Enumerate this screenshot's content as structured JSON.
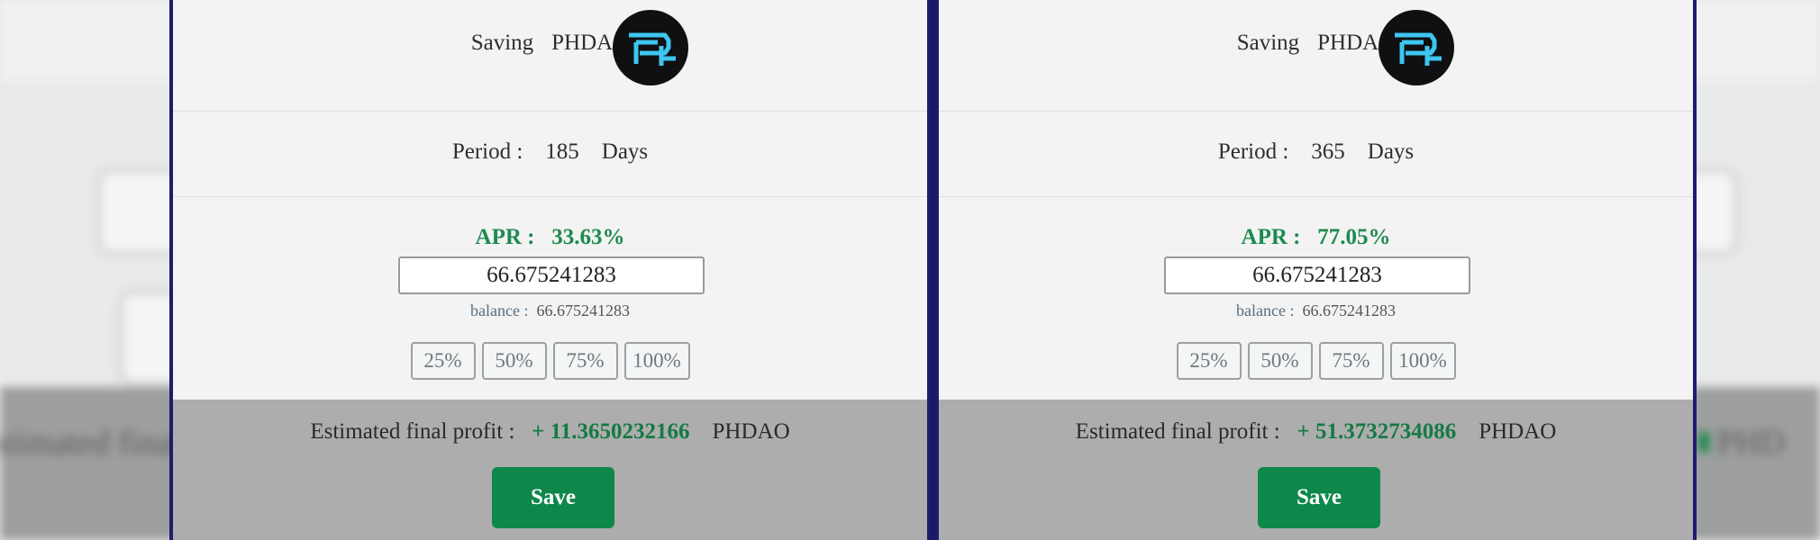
{
  "background": {
    "blurred_left_text": "Estimated final",
    "blurred_right_text": "PHD"
  },
  "panels": [
    {
      "saving_label": "Saving",
      "token": "PHDAO",
      "logo_icon": "phdao-logo-icon",
      "period_label": "Period :",
      "period_value": "185",
      "period_unit": "Days",
      "apr_label": "APR :",
      "apr_value": "33.63%",
      "amount_value": "66.675241283",
      "balance_label": "balance :",
      "balance_value": "66.675241283",
      "percent_buttons": [
        "25%",
        "50%",
        "75%",
        "100%"
      ],
      "profit_label": "Estimated final profit :",
      "profit_value": "+ 11.3650232166",
      "profit_unit": "PHDAO",
      "save_label": "Save"
    },
    {
      "saving_label": "Saving",
      "token": "PHDAO",
      "logo_icon": "phdao-logo-icon",
      "period_label": "Period :",
      "period_value": "365",
      "period_unit": "Days",
      "apr_label": "APR :",
      "apr_value": "77.05%",
      "amount_value": "66.675241283",
      "balance_label": "balance :",
      "balance_value": "66.675241283",
      "percent_buttons": [
        "25%",
        "50%",
        "75%",
        "100%"
      ],
      "profit_label": "Estimated final profit :",
      "profit_value": "+ 51.3732734086",
      "profit_unit": "PHDAO",
      "save_label": "Save"
    }
  ],
  "colors": {
    "accent_green": "#0e874a",
    "apr_green": "#1e8a50",
    "panel_border": "#1f1b6e",
    "logo_cyan": "#3ec6f0"
  }
}
